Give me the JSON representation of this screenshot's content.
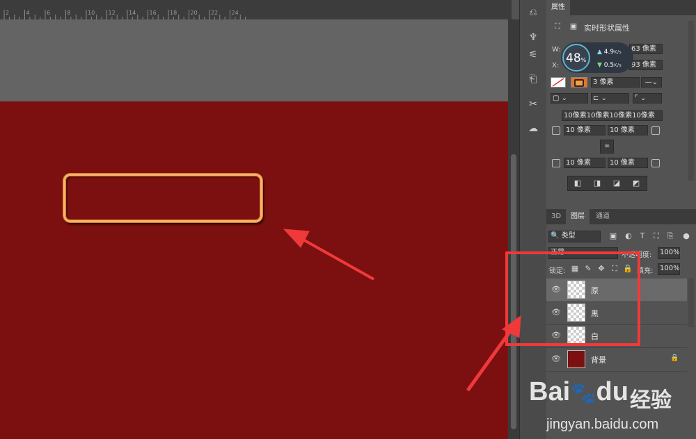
{
  "ruler": {
    "ticks": [
      "2",
      "4",
      "6",
      "8",
      "10",
      "12",
      "14",
      "16",
      "18",
      "20",
      "22",
      "24"
    ]
  },
  "properties_panel": {
    "tab_label": "属性",
    "section_title": "实时形状属性",
    "w_label": "W:",
    "w_value": "63 像素",
    "x_label": "X:",
    "x_value": "93 像素",
    "stroke_width": "3 像素",
    "radii_summary": "10像素10像素10像素10像素",
    "radius_tl": "10 像素",
    "radius_tr": "10 像素",
    "radius_bl": "10 像素",
    "radius_br": "10 像素"
  },
  "speed_widget": {
    "percent": "48",
    "percent_unit": "%",
    "up": "4.9",
    "up_unit": "K/s",
    "down": "0.5",
    "down_unit": "K/s"
  },
  "layers_panel": {
    "tabs": [
      "3D",
      "图层",
      "通道"
    ],
    "filter_label": "类型",
    "blend_mode": "正常",
    "opacity_label": "不透明度:",
    "opacity_value": "100%",
    "lock_label": "锁定:",
    "fill_label": "填充:",
    "fill_value": "100%",
    "layers": [
      {
        "name": "原",
        "selected": true
      },
      {
        "name": "黑",
        "selected": false
      },
      {
        "name": "白",
        "selected": false
      },
      {
        "name": "背景",
        "selected": false,
        "locked": true,
        "color": "#7c1010"
      }
    ]
  },
  "watermark": {
    "brand": "Bai",
    "brand2": "du",
    "cn": "经验",
    "url": "jingyan.baidu.com"
  },
  "colors": {
    "canvas": "#7c1010",
    "highlight_box": "#f0393a",
    "accent": "#e0762a"
  }
}
